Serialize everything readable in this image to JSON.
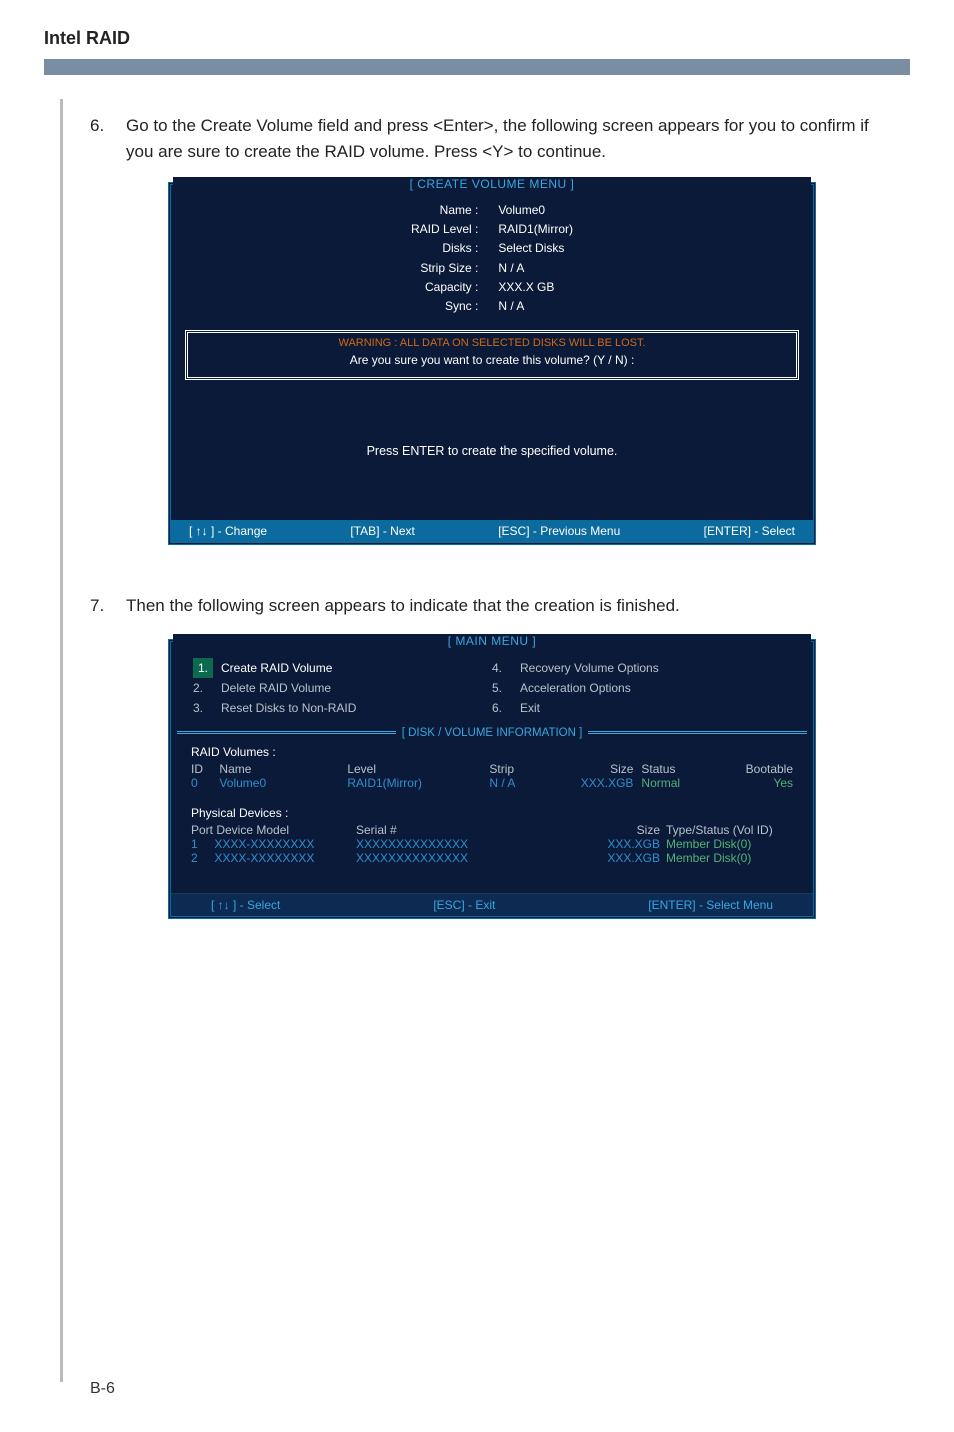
{
  "page": {
    "header": "Intel RAID",
    "page_number": "B-6"
  },
  "steps": {
    "s6_num": "6.",
    "s6_text": "Go to the Create Volume field and press <Enter>, the following screen appears for you to confirm if you are sure to create the RAID volume. Press <Y> to continue.",
    "s7_num": "7.",
    "s7_text": "Then the following screen appears to indicate that the creation is finished."
  },
  "create_volume_menu": {
    "title": "[  CREATE VOLUME MENU  ]",
    "labels": {
      "name": "Name :",
      "raid_level": "RAID Level :",
      "disks": "Disks :",
      "strip_size": "Strip Size :",
      "capacity": "Capacity :",
      "sync": "Sync :"
    },
    "values": {
      "name": "Volume0",
      "raid_level": "RAID1(Mirror)",
      "disks": "Select Disks",
      "strip_size": "N / A",
      "capacity": "XXX.X  GB",
      "sync": "N / A"
    },
    "warning": "WARNING : ALL DATA ON SELECTED DISKS WILL BE LOST.",
    "confirm": "Are  you  sure  you  want  to  create  this  volume?  (Y / N)  :",
    "press_enter": "Press  ENTER  to  create  the  specified  volume.",
    "footer": {
      "change": "[ ↑↓ ] - Change",
      "tab": "[TAB] - Next",
      "esc": "[ESC] - Previous Menu",
      "enter": "[ENTER] - Select"
    }
  },
  "main_menu": {
    "title": "[   MAIN  MENU   ]",
    "options": [
      {
        "num": "1.",
        "label": "Create  RAID  Volume",
        "selected": true
      },
      {
        "num": "2.",
        "label": "Delete  RAID  Volume",
        "selected": false
      },
      {
        "num": "3.",
        "label": "Reset Disks to Non-RAID",
        "selected": false
      },
      {
        "num": "4.",
        "label": "Recovery Volume  Options",
        "selected": false
      },
      {
        "num": "5.",
        "label": "Acceleration Options",
        "selected": false
      },
      {
        "num": "6.",
        "label": "Exit",
        "selected": false
      }
    ],
    "divider_label": "[   DISK / VOLUME INFORMATION   ]",
    "raid_volumes": {
      "title": "RAID  Volumes :",
      "headers": {
        "id": "ID",
        "name": "Name",
        "level": "Level",
        "strip": "Strip",
        "size": "Size",
        "status": "Status",
        "bootable": "Bootable"
      },
      "row": {
        "id": "0",
        "name": "Volume0",
        "level": "RAID1(Mirror)",
        "strip": "N / A",
        "size": "XXX.XGB",
        "status": "Normal",
        "bootable": "Yes"
      }
    },
    "physical_devices": {
      "title": "Physical  Devices :",
      "headers": {
        "port": "Port  Device  Model",
        "serial": "Serial  #",
        "size": "Size",
        "typestatus": "Type/Status (Vol  ID)"
      },
      "rows": [
        {
          "port": "1",
          "model": "XXXX-XXXXXXXX",
          "serial": "XXXXXXXXXXXXXX",
          "size": "XXX.XGB",
          "typestatus": "Member  Disk(0)"
        },
        {
          "port": "2",
          "model": "XXXX-XXXXXXXX",
          "serial": "XXXXXXXXXXXXXX",
          "size": "XXX.XGB",
          "typestatus": "Member  Disk(0)"
        }
      ]
    },
    "footer": {
      "select": "[ ↑↓ ] - Select",
      "esc": "[ESC] - Exit",
      "enter": "[ENTER] - Select Menu"
    }
  }
}
